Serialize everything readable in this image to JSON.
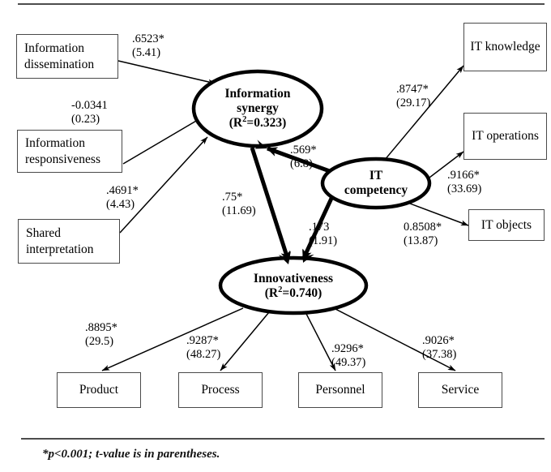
{
  "figure": {
    "type": "structural-equation-model-path-diagram",
    "footnote": "*p<0.001; t-value is in parentheses."
  },
  "observed_boxes": {
    "information_dissemination": "Information dissemination",
    "information_responsiveness": "Information responsiveness",
    "shared_interpretation": "Shared interpretation",
    "it_knowledge": "IT knowledge",
    "it_operations": "IT operations",
    "it_objects": "IT objects",
    "product": "Product",
    "process": "Process",
    "personnel": "Personnel",
    "service": "Service"
  },
  "latent_nodes": {
    "information_synergy": {
      "name": "Information synergy",
      "line1": "Information",
      "line2": "synergy",
      "r2": "(R²=0.323)",
      "r2_prefix": "(R",
      "r2_sup": "2",
      "r2_suffix": "=0.323)"
    },
    "it_competency": {
      "name": "IT competency",
      "line1": "IT",
      "line2": "competency"
    },
    "innovativeness": {
      "name": "Innovativeness",
      "line1": "Innovativeness",
      "r2": "(R²=0.740)",
      "r2_prefix": "(R",
      "r2_sup": "2",
      "r2_suffix": "=0.740)"
    }
  },
  "paths": [
    {
      "id": "dissemination-to-synergy",
      "from": "Information dissemination",
      "to": "Information synergy",
      "coefficient": ".6523*",
      "t_value": "(5.41)"
    },
    {
      "id": "responsiveness-to-synergy",
      "from": "Information responsiveness",
      "to": "Information synergy",
      "coefficient": "-0.0341",
      "t_value": "(0.23)"
    },
    {
      "id": "shared-interpretation-to-synergy",
      "from": "Shared interpretation",
      "to": "Information synergy",
      "coefficient": ".4691*",
      "t_value": "(4.43)"
    },
    {
      "id": "competency-to-synergy",
      "from": "IT competency",
      "to": "Information synergy",
      "coefficient": ".569*",
      "t_value": "(6.8)"
    },
    {
      "id": "synergy-to-innovativeness",
      "from": "Information synergy",
      "to": "Innovativeness",
      "coefficient": ".75*",
      "t_value": "(11.69)"
    },
    {
      "id": "competency-to-innovativeness",
      "from": "IT competency",
      "to": "Innovativeness",
      "coefficient": ".173",
      "t_value": "(1.91)"
    },
    {
      "id": "competency-to-it-knowledge",
      "from": "IT competency",
      "to": "IT knowledge",
      "coefficient": ".8747*",
      "t_value": "(29.17)"
    },
    {
      "id": "competency-to-it-operations",
      "from": "IT competency",
      "to": "IT operations",
      "coefficient": ".9166*",
      "t_value": "(33.69)"
    },
    {
      "id": "competency-to-it-objects",
      "from": "IT competency",
      "to": "IT objects",
      "coefficient": "0.8508*",
      "t_value": "(13.87)"
    },
    {
      "id": "innovativeness-to-product",
      "from": "Innovativeness",
      "to": "Product",
      "coefficient": ".8895*",
      "t_value": "(29.5)"
    },
    {
      "id": "innovativeness-to-process",
      "from": "Innovativeness",
      "to": "Process",
      "coefficient": ".9287*",
      "t_value": "(48.27)"
    },
    {
      "id": "innovativeness-to-personnel",
      "from": "Innovativeness",
      "to": "Personnel",
      "coefficient": ".9296*",
      "t_value": "(49.37)"
    },
    {
      "id": "innovativeness-to-service",
      "from": "Innovativeness",
      "to": "Service",
      "coefficient": ".9026*",
      "t_value": "(37.38)"
    }
  ],
  "colors": {
    "stroke": "#000000",
    "box_border": "#4a4a4a",
    "rule": "#4d4d4d",
    "background": "#ffffff"
  }
}
